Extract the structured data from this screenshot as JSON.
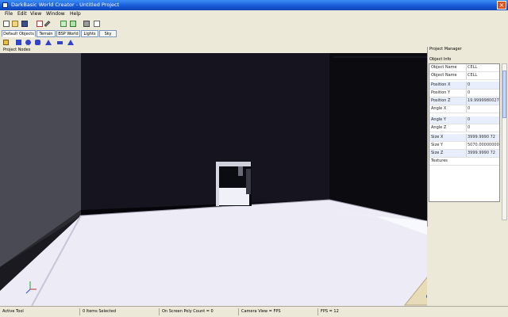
{
  "window": {
    "title": "DarkBasic World Creator - Untitled Project"
  },
  "menu": {
    "items": [
      "File",
      "Edit",
      "View",
      "Window",
      "Help"
    ]
  },
  "tabs": [
    "Default Objects",
    "Terrain",
    "BSP World",
    "Lights",
    "Sky"
  ],
  "panel": {
    "header": "Project Nodes"
  },
  "project_manager": {
    "title": "Project Manager",
    "section": "Object Info",
    "properties": [
      {
        "key": "Object Name",
        "value": "CELL"
      },
      {
        "key": "Object Name",
        "value": "CELL"
      },
      {
        "key": "Position X",
        "value": "0"
      },
      {
        "key": "Position Y",
        "value": "0"
      },
      {
        "key": "Position Z",
        "value": "19.99999800277"
      },
      {
        "key": "Angle X",
        "value": "0"
      },
      {
        "key": "Angle Y",
        "value": "0"
      },
      {
        "key": "Angle Z",
        "value": "0"
      },
      {
        "key": "Size X",
        "value": "3999.9990   72"
      },
      {
        "key": "Size Y",
        "value": "5070.000000000"
      },
      {
        "key": "Size Z",
        "value": "3999.9990   72"
      },
      {
        "key": "Textures",
        "value": ""
      }
    ]
  },
  "status": {
    "tool": "Active Tool",
    "selected": "0 Items Selected",
    "polycount": "On Screen Poly Count = 0",
    "camera": "Camera View = FPS",
    "fps": "FPS = 12"
  }
}
